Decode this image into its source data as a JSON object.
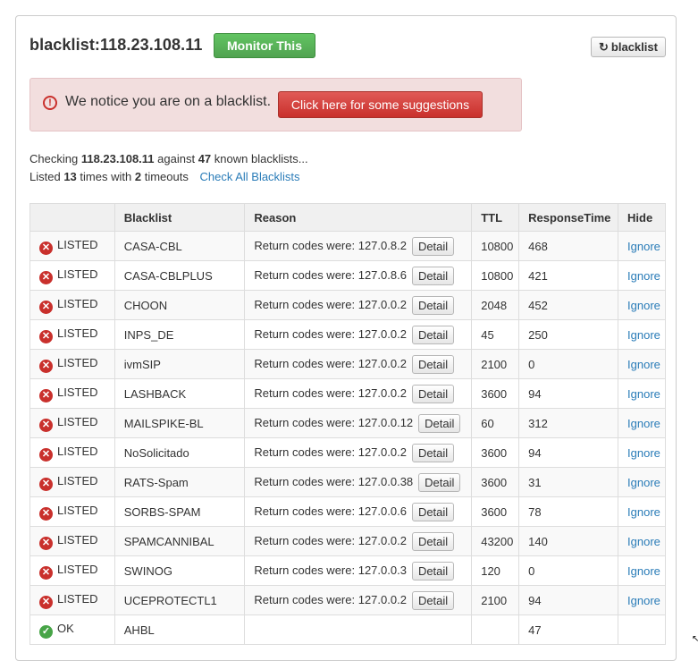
{
  "header": {
    "title": "blacklist:118.23.108.11",
    "monitor_label": "Monitor This",
    "refresh_label": "blacklist"
  },
  "alert": {
    "message": "We notice you are on a blacklist.",
    "button_label": "Click here for some suggestions"
  },
  "summary": {
    "line1_prefix": "Checking",
    "ip": "118.23.108.11",
    "line1_mid": "against",
    "count": "47",
    "line1_suffix": "known blacklists...",
    "line2_prefix": "Listed",
    "listed_count": "13",
    "line2_mid": "times with",
    "timeouts": "2",
    "line2_suffix": "timeouts",
    "check_all_label": "Check All Blacklists"
  },
  "table": {
    "headers": [
      "",
      "Blacklist",
      "Reason",
      "TTL",
      "ResponseTime",
      "Hide"
    ],
    "detail_label": "Detail",
    "ignore_label": "Ignore",
    "rows": [
      {
        "status": "LISTED",
        "blacklist": "CASA-CBL",
        "reason": "Return codes were: 127.0.8.2",
        "ttl": "10800",
        "response": "468"
      },
      {
        "status": "LISTED",
        "blacklist": "CASA-CBLPLUS",
        "reason": "Return codes were: 127.0.8.6",
        "ttl": "10800",
        "response": "421"
      },
      {
        "status": "LISTED",
        "blacklist": "CHOON",
        "reason": "Return codes were: 127.0.0.2",
        "ttl": "2048",
        "response": "452"
      },
      {
        "status": "LISTED",
        "blacklist": "INPS_DE",
        "reason": "Return codes were: 127.0.0.2",
        "ttl": "45",
        "response": "250"
      },
      {
        "status": "LISTED",
        "blacklist": "ivmSIP",
        "reason": "Return codes were: 127.0.0.2",
        "ttl": "2100",
        "response": "0"
      },
      {
        "status": "LISTED",
        "blacklist": "LASHBACK",
        "reason": "Return codes were: 127.0.0.2",
        "ttl": "3600",
        "response": "94"
      },
      {
        "status": "LISTED",
        "blacklist": "MAILSPIKE-BL",
        "reason": "Return codes were: 127.0.0.12",
        "ttl": "60",
        "response": "312"
      },
      {
        "status": "LISTED",
        "blacklist": "NoSolicitado",
        "reason": "Return codes were: 127.0.0.2",
        "ttl": "3600",
        "response": "94"
      },
      {
        "status": "LISTED",
        "blacklist": "RATS-Spam",
        "reason": "Return codes were: 127.0.0.38",
        "ttl": "3600",
        "response": "31"
      },
      {
        "status": "LISTED",
        "blacklist": "SORBS-SPAM",
        "reason": "Return codes were: 127.0.0.6",
        "ttl": "3600",
        "response": "78"
      },
      {
        "status": "LISTED",
        "blacklist": "SPAMCANNIBAL",
        "reason": "Return codes were: 127.0.0.2",
        "ttl": "43200",
        "response": "140"
      },
      {
        "status": "LISTED",
        "blacklist": "SWINOG",
        "reason": "Return codes were: 127.0.0.3",
        "ttl": "120",
        "response": "0"
      },
      {
        "status": "LISTED",
        "blacklist": "UCEPROTECTL1",
        "reason": "Return codes were: 127.0.0.2",
        "ttl": "2100",
        "response": "94"
      },
      {
        "status": "OK",
        "blacklist": "AHBL",
        "reason": "",
        "ttl": "",
        "response": "47"
      }
    ]
  },
  "icons": {
    "refresh": "refresh-icon",
    "alert": "exclamation-circle-icon",
    "listed": "x-circle-icon",
    "ok": "check-circle-icon"
  },
  "colors": {
    "listed": "#c9302c",
    "ok": "#47a447",
    "monitor_button": "#51a351",
    "link": "#2a7cb8",
    "alert_bg": "#f2dede"
  }
}
